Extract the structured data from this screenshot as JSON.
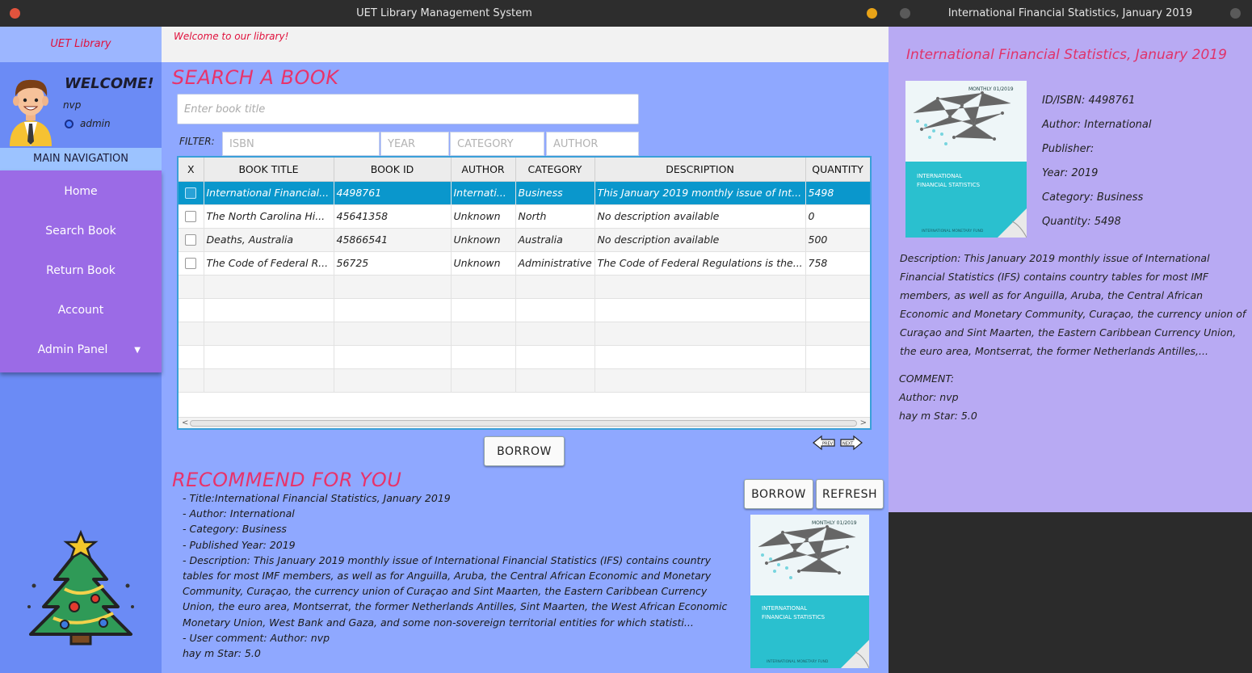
{
  "main_window": {
    "title": "UET Library Management System",
    "welcome_banner": "Welcome to our library!"
  },
  "sidebar": {
    "brand": "UET Library",
    "welcome": "WELCOME!",
    "username": "nvp",
    "role": "admin",
    "nav_header": "MAIN NAVIGATION",
    "items": [
      {
        "label": "Home"
      },
      {
        "label": "Search Book"
      },
      {
        "label": "Return Book"
      },
      {
        "label": "Account"
      },
      {
        "label": "Admin Panel"
      }
    ]
  },
  "search": {
    "heading": "SEARCH A BOOK",
    "placeholder": "Enter book title",
    "filter_label": "FILTER:",
    "filters": {
      "isbn": "ISBN",
      "year": "YEAR",
      "category": "CATEGORY",
      "author": "AUTHOR"
    }
  },
  "table": {
    "headers": [
      "X",
      "BOOK TITLE",
      "BOOK ID",
      "AUTHOR",
      "CATEGORY",
      "DESCRIPTION",
      "QUANTITY"
    ],
    "rows": [
      {
        "title": "International Financial...",
        "id": "4498761",
        "author": "Internati...",
        "category": "Business",
        "description": "This January 2019 monthly issue of Int...",
        "quantity": "5498"
      },
      {
        "title": "The North Carolina Hi...",
        "id": "45641358",
        "author": "Unknown",
        "category": "North",
        "description": "No description available",
        "quantity": "0"
      },
      {
        "title": "Deaths, Australia",
        "id": "45866541",
        "author": "Unknown",
        "category": "Australia",
        "description": "No description available",
        "quantity": "500"
      },
      {
        "title": "The Code of Federal R...",
        "id": "56725",
        "author": "Unknown",
        "category": "Administrative",
        "description": "The Code of Federal Regulations is the...",
        "quantity": "758"
      }
    ]
  },
  "actions": {
    "borrow": "BORROW",
    "prev": "PREV",
    "next": "NEXT",
    "refresh": "REFRESH"
  },
  "recommend": {
    "heading": "RECOMMEND FOR YOU",
    "lines": [
      "- Title:International Financial Statistics, January 2019",
      "- Author: International",
      "- Category: Business",
      "- Published Year: 2019",
      "- Description: This January 2019 monthly issue of International Financial Statistics (IFS) contains country tables for most IMF members, as well as for Anguilla, Aruba, the Central African Economic and Monetary Community, Curaçao, the currency union of Curaçao and Sint Maarten, the Eastern Caribbean Currency Union, the euro area, Montserrat, the former Netherlands Antilles, Sint Maarten, the West African Economic Monetary Union, West Bank and Gaza, and some non-sovereign territorial entities for which statisti...",
      "- User comment: Author: nvp",
      "hay m Star: 5.0"
    ]
  },
  "cover": {
    "issue": "MONTHLY 01/2019",
    "title_line1": "INTERNATIONAL",
    "title_line2": "FINANCIAL STATISTICS",
    "footer": "INTERNATIONAL MONETARY FUND"
  },
  "detail_window": {
    "title": "International Financial Statistics, January 2019",
    "heading": "International Financial Statistics, January 2019",
    "isbn": "ID/ISBN: 4498761",
    "author": "Author: International",
    "publisher": "Publisher:",
    "year": "Year: 2019",
    "category": "Category: Business",
    "quantity": "Quantity: 5498",
    "description": "Description: This January 2019 monthly issue of International Financial Statistics (IFS) contains country tables for most IMF members, as well as for Anguilla, Aruba, the Central African Economic and Monetary Community, Curaçao, the currency union of Curaçao and Sint Maarten, the Eastern Caribbean Currency Union, the euro area, Montserrat, the former Netherlands Antilles,...",
    "comment_label": "COMMENT:",
    "comment_author": "Author: nvp",
    "comment_star": "hay m Star: 5.0"
  },
  "colors": {
    "accent_heading": "#e8336b",
    "selection": "#0a97cc",
    "sidebar_menu": "#9b6be6",
    "content_bg": "#8fa8ff",
    "detail_bg": "#b8aaf3"
  }
}
